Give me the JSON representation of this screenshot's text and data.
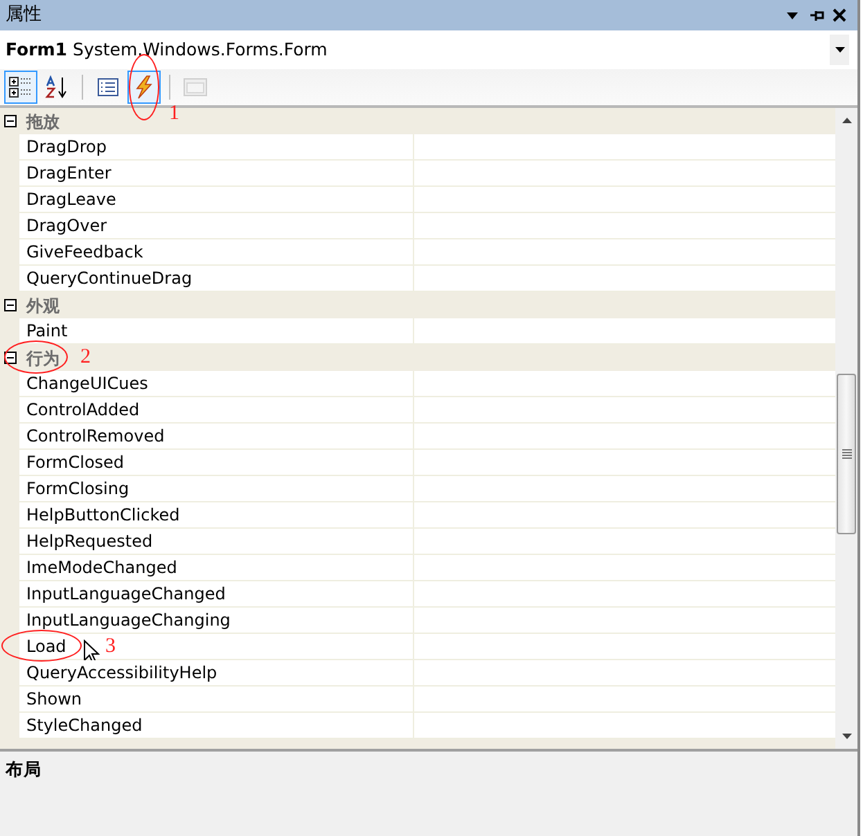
{
  "window": {
    "title": "属性"
  },
  "object_selector": {
    "name": "Form1",
    "type": "System.Windows.Forms.Form"
  },
  "toolbar": [
    {
      "kind": "categorized",
      "selected": true,
      "disabled": false
    },
    {
      "kind": "alphabetical",
      "selected": false,
      "disabled": false
    },
    {
      "kind": "separator"
    },
    {
      "kind": "properties",
      "selected": false,
      "disabled": false
    },
    {
      "kind": "events",
      "selected": true,
      "disabled": false,
      "annotation": "1"
    },
    {
      "kind": "separator"
    },
    {
      "kind": "property_pages",
      "selected": false,
      "disabled": true
    }
  ],
  "categories": [
    {
      "name": "拖放",
      "expanded": true,
      "items": [
        {
          "name": "DragDrop"
        },
        {
          "name": "DragEnter"
        },
        {
          "name": "DragLeave"
        },
        {
          "name": "DragOver"
        },
        {
          "name": "GiveFeedback"
        },
        {
          "name": "QueryContinueDrag"
        }
      ]
    },
    {
      "name": "外观",
      "expanded": true,
      "items": [
        {
          "name": "Paint"
        }
      ]
    },
    {
      "name": "行为",
      "expanded": true,
      "annotation": "2",
      "items": [
        {
          "name": "ChangeUICues"
        },
        {
          "name": "ControlAdded"
        },
        {
          "name": "ControlRemoved"
        },
        {
          "name": "FormClosed"
        },
        {
          "name": "FormClosing"
        },
        {
          "name": "HelpButtonClicked"
        },
        {
          "name": "HelpRequested"
        },
        {
          "name": "ImeModeChanged"
        },
        {
          "name": "InputLanguageChanged"
        },
        {
          "name": "InputLanguageChanging"
        },
        {
          "name": "Load",
          "annotation": "3"
        },
        {
          "name": "QueryAccessibilityHelp"
        },
        {
          "name": "Shown"
        },
        {
          "name": "StyleChanged"
        }
      ]
    }
  ],
  "description": {
    "title": "布局"
  }
}
